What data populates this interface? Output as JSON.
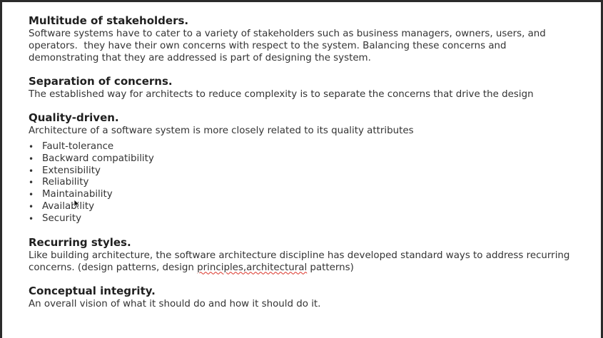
{
  "sections": {
    "stakeholders": {
      "heading": "Multitude of stakeholders.",
      "line1": "Software systems have to cater to a variety of stakeholders such as business managers, owners, users, and",
      "line2": "operators.  they have their own concerns with respect to the system. Balancing these concerns and",
      "line3": "demonstrating that they are addressed is part of designing the system."
    },
    "separation": {
      "heading": "Separation of concerns.",
      "line1": "The established way for architects to reduce complexity is to separate the concerns that drive the design"
    },
    "quality": {
      "heading": "Quality-driven.",
      "line1": "Architecture of a software system is more closely related to its quality attributes",
      "bullets": [
        "Fault-tolerance",
        "Backward compatibility",
        "Extensibility",
        "Reliability",
        "Maintainability",
        "Availability",
        "Security"
      ]
    },
    "recurring": {
      "heading": "Recurring styles.",
      "line1": "Like building architecture, the software architecture discipline has developed standard ways to address recurring",
      "line2_pre": "concerns. (design patterns, design ",
      "line2_misspelled": "principles,architectural",
      "line2_post": " patterns)"
    },
    "integrity": {
      "heading": "Conceptual integrity.",
      "line1": "An overall vision of what it should do and how it should do it."
    }
  },
  "bullet_char": "•",
  "icons": {
    "cursor": "mouse-pointer-icon"
  }
}
